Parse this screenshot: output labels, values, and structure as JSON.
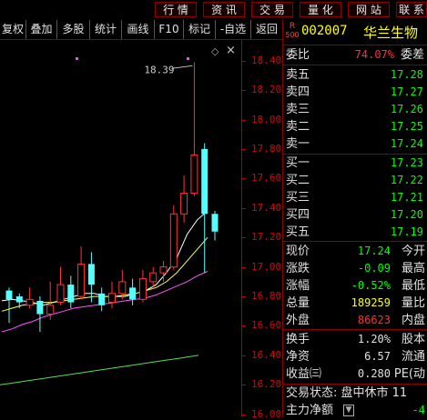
{
  "top_menu": [
    "行 情",
    "资 讯",
    "交 易",
    "量 化",
    "网 站",
    "联 系"
  ],
  "toolbar": [
    "复权",
    "叠加",
    "多股",
    "统计",
    "画线",
    "F10",
    "标记",
    "-自选",
    "返回"
  ],
  "chart": {
    "peak_label": "18.39",
    "price_axis": [
      "18.40",
      "18.20",
      "18.00",
      "17.80",
      "17.60",
      "17.40",
      "17.20",
      "17.00",
      "16.80",
      "16.60",
      "16.40",
      "16.20",
      "16.00"
    ]
  },
  "chart_data": {
    "type": "candlestick",
    "y_ticks": [
      18.4,
      18.2,
      18.0,
      17.8,
      17.6,
      17.4,
      17.2,
      17.0,
      16.8,
      16.6,
      16.4,
      16.2,
      16.0
    ],
    "ylim": [
      15.98,
      18.54
    ],
    "candles": [
      {
        "o": 16.84,
        "c": 16.78,
        "h": 16.86,
        "l": 16.62
      },
      {
        "o": 16.8,
        "c": 16.76,
        "h": 16.82,
        "l": 16.72
      },
      {
        "o": 16.74,
        "c": 16.78,
        "h": 16.86,
        "l": 16.72
      },
      {
        "o": 16.77,
        "c": 16.68,
        "h": 16.8,
        "l": 16.56
      },
      {
        "o": 16.68,
        "c": 16.74,
        "h": 16.9,
        "l": 16.64
      },
      {
        "o": 16.76,
        "c": 16.88,
        "h": 17.0,
        "l": 16.74
      },
      {
        "o": 16.88,
        "c": 16.76,
        "h": 16.94,
        "l": 16.72
      },
      {
        "o": 16.8,
        "c": 17.02,
        "h": 17.14,
        "l": 16.78
      },
      {
        "o": 17.02,
        "c": 16.88,
        "h": 17.1,
        "l": 16.76
      },
      {
        "o": 16.82,
        "c": 16.74,
        "h": 16.86,
        "l": 16.7
      },
      {
        "o": 16.76,
        "c": 16.82,
        "h": 16.9,
        "l": 16.72
      },
      {
        "o": 16.82,
        "c": 16.9,
        "h": 16.98,
        "l": 16.78
      },
      {
        "o": 16.86,
        "c": 16.78,
        "h": 16.92,
        "l": 16.74
      },
      {
        "o": 16.78,
        "c": 16.92,
        "h": 16.98,
        "l": 16.76
      },
      {
        "o": 16.9,
        "c": 16.96,
        "h": 17.0,
        "l": 16.86
      },
      {
        "o": 16.96,
        "c": 17.0,
        "h": 17.04,
        "l": 16.9
      },
      {
        "o": 17.0,
        "c": 17.36,
        "h": 17.42,
        "l": 16.98
      },
      {
        "o": 17.36,
        "c": 17.5,
        "h": 17.62,
        "l": 17.3
      },
      {
        "o": 17.5,
        "c": 17.76,
        "h": 18.39,
        "l": 17.48
      },
      {
        "o": 17.8,
        "c": 17.36,
        "h": 17.84,
        "l": 16.96
      },
      {
        "o": 17.36,
        "c": 17.24,
        "h": 17.38,
        "l": 17.18
      }
    ],
    "ma_lines": [
      {
        "color": "#ffffff",
        "values": [
          16.77,
          16.78,
          16.77,
          16.76,
          16.74,
          16.76,
          16.78,
          16.8,
          16.82,
          16.82,
          16.8,
          16.8,
          16.8,
          16.82,
          16.84,
          16.88,
          16.96,
          17.06,
          17.22,
          17.32,
          17.38
        ]
      },
      {
        "color": "#ffff55",
        "values": [
          16.7,
          16.72,
          16.74,
          16.75,
          16.76,
          16.76,
          16.77,
          16.78,
          16.79,
          16.8,
          16.8,
          16.8,
          16.81,
          16.82,
          16.84,
          16.86,
          16.9,
          16.96,
          17.04,
          17.12,
          17.2
        ]
      },
      {
        "color": "#ff55ff",
        "values": [
          16.56,
          16.58,
          16.61,
          16.63,
          16.66,
          16.68,
          16.7,
          16.72,
          16.73,
          16.74,
          16.75,
          16.76,
          16.77,
          16.78,
          16.79,
          16.81,
          16.84,
          16.87,
          16.9,
          16.94,
          16.97
        ]
      },
      {
        "color": "#55dd55",
        "values": [
          16.2,
          16.21,
          16.22,
          16.23,
          16.24,
          16.25,
          16.26,
          16.27,
          16.28,
          16.29,
          16.3,
          16.31,
          16.32,
          16.33,
          16.34,
          16.35,
          16.36,
          16.37,
          16.38,
          16.39,
          16.4
        ]
      }
    ]
  },
  "quote": {
    "code": "002007",
    "name": "华兰生物",
    "weibi_label": "委比",
    "weibi": "74.07%",
    "weicha_label": "委差",
    "asks": [
      {
        "label": "卖五",
        "price": "17.28"
      },
      {
        "label": "卖四",
        "price": "17.27"
      },
      {
        "label": "卖三",
        "price": "17.26"
      },
      {
        "label": "卖二",
        "price": "17.25"
      },
      {
        "label": "卖一",
        "price": "17.24"
      }
    ],
    "bids": [
      {
        "label": "买一",
        "price": "17.23"
      },
      {
        "label": "买二",
        "price": "17.22"
      },
      {
        "label": "买三",
        "price": "17.21"
      },
      {
        "label": "买四",
        "price": "17.20"
      },
      {
        "label": "买五",
        "price": "17.19"
      }
    ],
    "stats": [
      {
        "label": "现价",
        "value": "17.24",
        "color": "#00ff00",
        "right": "今开"
      },
      {
        "label": "涨跌",
        "value": "-0.09",
        "color": "#00ff00",
        "right": "最高"
      },
      {
        "label": "涨幅",
        "value": "-0.52%",
        "color": "#00ff00",
        "right": "最低"
      },
      {
        "label": "总量",
        "value": "189259",
        "color": "#ffff00",
        "right": "量比"
      },
      {
        "label": "外盘",
        "value": "86623",
        "color": "#ff3333",
        "right": "内盘"
      }
    ],
    "stats2": [
      {
        "label": "换手",
        "value": "1.20%",
        "right": "股本"
      },
      {
        "label": "净资",
        "value": "6.57",
        "right": "流通"
      },
      {
        "label": "收益㈢",
        "value": "0.280",
        "right": "PE(动"
      }
    ],
    "status": "交易状态: 盘中休市 11",
    "net_label": "主力净额",
    "net_value": "-4"
  }
}
